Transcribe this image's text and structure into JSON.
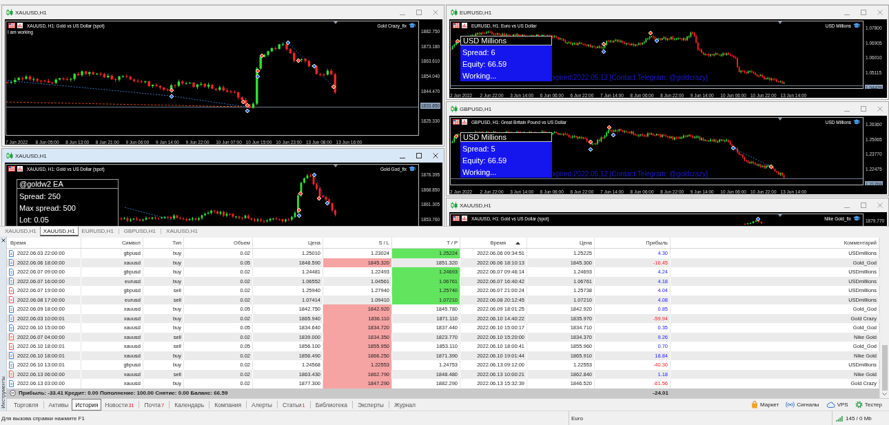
{
  "chart_area": {
    "columns": [
      {
        "windows": [
          {
            "title": "XAUUSD,H1",
            "active": false,
            "chart": {
              "symbol_label": "XAUUSD, H1: Gold vs US Dollar (spot)",
              "expert": "Gold Crazy_fix",
              "comment": "I am working",
              "price_labels": [
                {
                  "text": "1882.750",
                  "current": false
                },
                {
                  "text": "1873.180",
                  "current": false
                },
                {
                  "text": "1863.610",
                  "current": false
                },
                {
                  "text": "1854.040",
                  "current": false
                },
                {
                  "text": "1844.470",
                  "current": false
                },
                {
                  "text": "1833.850",
                  "current": true
                },
                {
                  "text": "1825.330",
                  "current": false
                }
              ],
              "time_labels": [
                "7 Jun 2022",
                "8 Jun 05:00",
                "8 Jun 13:00",
                "8 Jun 21:00",
                "9 Jun 06:00",
                "9 Jun 14:00",
                "9 Jun 22:00",
                "10 Jun 07:00",
                "10 Jun 15:00",
                "10 Jun 23:00",
                "13 Jun 08:00",
                "13 Jun 16:00"
              ]
            }
          },
          {
            "title": "XAUUSD,H1",
            "active": true,
            "chart": {
              "symbol_label": "XAUUSD, H1: Gold vs US Dollar (spot)",
              "expert": "Gold God_fix",
              "panel": {
                "kind": "outline",
                "title": "@goldw2 EA",
                "lines": [
                  "Spread: 250",
                  "Max spread: 500",
                  "Lot: 0.05"
                ]
              },
              "price_labels": [
                {
                  "text": "1876.395",
                  "current": false
                },
                {
                  "text": "1868.850",
                  "current": false
                },
                {
                  "text": "1861.305",
                  "current": false
                },
                {
                  "text": "1853.760",
                  "current": false
                }
              ]
            }
          }
        ]
      },
      {
        "windows": [
          {
            "title": "EURUSD,H1",
            "active": false,
            "chart": {
              "symbol_label": "EURUSD, H1: Euro vs US Dollar",
              "expert": "USD Millions",
              "panel": {
                "kind": "filled",
                "title": "USD Millions",
                "lines": [
                  "Spread: 6",
                  "Equity: 66.59",
                  "Working..."
                ]
              },
              "notice": "xpired:2022.05.12 [Contact Telegram: @goldcrazy]",
              "price_labels": [
                {
                  "text": "1.07800",
                  "current": false
                },
                {
                  "text": "1.06905",
                  "current": false
                },
                {
                  "text": "1.06010",
                  "current": false
                },
                {
                  "text": "1.05115",
                  "current": false
                },
                {
                  "text": "1.04429",
                  "current": true
                }
              ],
              "time_labels": [
                "2 Jun 2022",
                "2 Jun 22:00",
                "3 Jun 14:00",
                "6 Jun 06:00",
                "6 Jun 22:00",
                "7 Jun 14:00",
                "8 Jun 06:00",
                "8 Jun 22:00",
                "9 Jun 14:00",
                "10 Jun 06:00",
                "10 Jun 22:00",
                "13 Jun 14:00"
              ]
            }
          },
          {
            "title": "GBPUSD,H1",
            "active": false,
            "chart": {
              "symbol_label": "GBPUSD, H1: Great Britain Pound vs US Dollar",
              "expert": "USD Millions",
              "panel": {
                "kind": "filled",
                "title": "USD Millions",
                "lines": [
                  "Spread: 5",
                  "Equity: 66.59",
                  "Working..."
                ]
              },
              "notice": "xpired:2022.05.12 [Contact Telegram: @goldcrazy]",
              "price_labels": [
                {
                  "text": "1.26360",
                  "current": false
                },
                {
                  "text": "1.25065",
                  "current": false
                },
                {
                  "text": "1.23770",
                  "current": false
                },
                {
                  "text": "1.22475",
                  "current": false
                },
                {
                  "text": "1.21769",
                  "current": true
                }
              ],
              "time_labels": [
                "2 Jun 2022",
                "2 Jun 22:00",
                "3 Jun 14:00",
                "6 Jun 06:00",
                "6 Jun 22:00",
                "7 Jun 14:00",
                "8 Jun 06:00",
                "8 Jun 22:00",
                "9 Jun 14:00",
                "10 Jun 06:00",
                "10 Jun 22:00",
                "13 Jun 14:00"
              ]
            }
          },
          {
            "title": "XAUUSD,H1",
            "active": false,
            "chart": {
              "symbol_label": "XAUUSD, H1: Gold vs US Dollar (spot)",
              "expert": "Nike Gold_fix",
              "price_labels": [
                {
                  "text": "1879.770",
                  "current": false
                }
              ]
            }
          }
        ]
      }
    ]
  },
  "chart_tabs": [
    {
      "label": "XAUUSD,H1",
      "selected": false
    },
    {
      "label": "XAUUSD,H1",
      "selected": true
    },
    {
      "label": "EURUSD,H1",
      "selected": false
    },
    {
      "label": "GBPUSD,H1",
      "selected": false
    },
    {
      "label": "XAUUSD,H1",
      "selected": false
    }
  ],
  "toolbox": {
    "label": "Инструменты",
    "table": {
      "columns": [
        {
          "label": "Время",
          "sorted": false
        },
        {
          "label": "Символ",
          "sorted": false
        },
        {
          "label": "Тип",
          "sorted": false
        },
        {
          "label": "Объем",
          "sorted": false
        },
        {
          "label": "Цена",
          "sorted": false
        },
        {
          "label": "S / L",
          "sorted": false
        },
        {
          "label": "T / P",
          "sorted": false
        },
        {
          "label": "Время",
          "sorted": true
        },
        {
          "label": "Цена",
          "sorted": false
        },
        {
          "label": "Прибыль",
          "sorted": false
        },
        {
          "label": "Комментарий",
          "sorted": false
        }
      ],
      "rows": [
        {
          "time": "2022.06.03 22:00:00",
          "color": "#3d7fc6",
          "symbol": "gbpusd",
          "type": "buy",
          "volume": "0.02",
          "price": "1.25010",
          "sl": "1.23024",
          "sl_hit": false,
          "tp": "1.25224",
          "tp_hit": true,
          "close_time": "2022.06.06 09:34:51",
          "close_price": "1.25225",
          "profit": "4.30",
          "loss": false,
          "comment": "USDmillions"
        },
        {
          "time": "2022.06.06 18:00:00",
          "color": "#3d7fc6",
          "symbol": "xauusd",
          "type": "buy",
          "volume": "0.05",
          "price": "1848.590",
          "sl": "1845.320",
          "sl_hit": true,
          "tp": "1851.320",
          "tp_hit": false,
          "close_time": "2022.06.06 18:10:13",
          "close_price": "1845.300",
          "profit": "-16.45",
          "loss": true,
          "comment": "Gold_God"
        },
        {
          "time": "2022.06.07 09:00:00",
          "color": "#3d7fc6",
          "symbol": "gbpusd",
          "type": "buy",
          "volume": "0.02",
          "price": "1.24481",
          "sl": "1.22493",
          "sl_hit": false,
          "tp": "1.24693",
          "tp_hit": true,
          "close_time": "2022.06.07 09:46:14",
          "close_price": "1.24693",
          "profit": "4.24",
          "loss": false,
          "comment": "USDmillions"
        },
        {
          "time": "2022.06.07 16:00:00",
          "color": "#3d7fc6",
          "symbol": "eurusd",
          "type": "buy",
          "volume": "0.02",
          "price": "1.06552",
          "sl": "1.04561",
          "sl_hit": false,
          "tp": "1.06761",
          "tp_hit": true,
          "close_time": "2022.06.07 16:40:42",
          "close_price": "1.06761",
          "profit": "4.18",
          "loss": false,
          "comment": "USDmillions"
        },
        {
          "time": "2022.06.07 19:00:00",
          "color": "#e0574a",
          "symbol": "gbpusd",
          "type": "sell",
          "volume": "0.02",
          "price": "1.25940",
          "sl": "1.27940",
          "sl_hit": false,
          "tp": "1.25740",
          "tp_hit": true,
          "close_time": "2022.06.07 21:00:24",
          "close_price": "1.25738",
          "profit": "4.04",
          "loss": false,
          "comment": "USDmillions"
        },
        {
          "time": "2022.06.08 17:00:00",
          "color": "#e0574a",
          "symbol": "eurusd",
          "type": "sell",
          "volume": "0.02",
          "price": "1.07414",
          "sl": "1.09410",
          "sl_hit": false,
          "tp": "1.07210",
          "tp_hit": true,
          "close_time": "2022.06.08 20:12:45",
          "close_price": "1.07210",
          "profit": "4.08",
          "loss": false,
          "comment": "USDmillions"
        },
        {
          "time": "2022.06.09 18:00:00",
          "color": "#3d7fc6",
          "symbol": "xauusd",
          "type": "buy",
          "volume": "0.05",
          "price": "1842.750",
          "sl": "1842.920",
          "sl_hit": true,
          "tp": "1845.780",
          "tp_hit": false,
          "close_time": "2022.06.09 18:01:25",
          "close_price": "1842.920",
          "profit": "0.85",
          "loss": false,
          "comment": "Gold_God"
        },
        {
          "time": "2022.06.03 10:00:01",
          "color": "#3d7fc6",
          "symbol": "xauusd",
          "type": "buy",
          "volume": "0.02",
          "price": "1865.940",
          "sl": "1836.110",
          "sl_hit": true,
          "tp": "1871.110",
          "tp_hit": false,
          "close_time": "2022.06.10 14:40:22",
          "close_price": "1835.970",
          "profit": "-59.94",
          "loss": true,
          "comment": "Gold Crazy"
        },
        {
          "time": "2022.06.10 15:00:00",
          "color": "#3d7fc6",
          "symbol": "xauusd",
          "type": "buy",
          "volume": "0.05",
          "price": "1834.640",
          "sl": "1834.720",
          "sl_hit": true,
          "tp": "1837.440",
          "tp_hit": false,
          "close_time": "2022.06.10 15:00:17",
          "close_price": "1834.710",
          "profit": "0.35",
          "loss": false,
          "comment": "Gold_God"
        },
        {
          "time": "2022.06.07 04:00:00",
          "color": "#e0574a",
          "symbol": "xauusd",
          "type": "sell",
          "volume": "0.02",
          "price": "1839.000",
          "sl": "1834.350",
          "sl_hit": true,
          "tp": "1823.770",
          "tp_hit": false,
          "close_time": "2022.06.10 15:20:00",
          "close_price": "1834.370",
          "profit": "9.26",
          "loss": false,
          "comment": "Nike Gold"
        },
        {
          "time": "2022.06.10 18:00:01",
          "color": "#e0574a",
          "symbol": "xauusd",
          "type": "sell",
          "volume": "0.05",
          "price": "1856.100",
          "sl": "1855.950",
          "sl_hit": true,
          "tp": "1853.110",
          "tp_hit": false,
          "close_time": "2022.06.10 18:00:41",
          "close_price": "1855.960",
          "profit": "0.70",
          "loss": false,
          "comment": "Gold_God"
        },
        {
          "time": "2022.06.10 18:00:01",
          "color": "#3d7fc6",
          "symbol": "xauusd",
          "type": "buy",
          "volume": "0.02",
          "price": "1856.490",
          "sl": "1866.250",
          "sl_hit": true,
          "tp": "1871.390",
          "tp_hit": false,
          "close_time": "2022.06.10 19:01:44",
          "close_price": "1865.910",
          "profit": "18.84",
          "loss": false,
          "comment": "Nike Gold"
        },
        {
          "time": "2022.06.10 13:00:01",
          "color": "#3d7fc6",
          "symbol": "gbpusd",
          "type": "buy",
          "volume": "0.02",
          "price": "1.24568",
          "sl": "1.22553",
          "sl_hit": true,
          "tp": "1.24753",
          "tp_hit": false,
          "close_time": "2022.06.13 09:12:00",
          "close_price": "1.22553",
          "profit": "-40.30",
          "loss": true,
          "comment": "USDmillions"
        },
        {
          "time": "2022.06.13 06:00:00",
          "color": "#e0574a",
          "symbol": "xauusd",
          "type": "sell",
          "volume": "0.02",
          "price": "1863.430",
          "sl": "1862.790",
          "sl_hit": true,
          "tp": "1848.480",
          "tp_hit": false,
          "close_time": "2022.06.13 10:00:21",
          "close_price": "1862.840",
          "profit": "1.18",
          "loss": false,
          "comment": "Nike Gold"
        },
        {
          "time": "2022.06.13 03:00:00",
          "color": "#3d7fc6",
          "symbol": "xauusd",
          "type": "buy",
          "volume": "0.02",
          "price": "1877.300",
          "sl": "1847.290",
          "sl_hit": true,
          "tp": "1882.290",
          "tp_hit": false,
          "close_time": "2022.06.13 15:32:39",
          "close_price": "1846.520",
          "profit": "-61.56",
          "loss": true,
          "comment": "Gold Crazy"
        }
      ],
      "summary": {
        "text": "Прибыль: -33.41 Кредит: 0.00 Пополнение: 100.00 Снятие: 0.00 Баланс: 66.59",
        "total_profit": "-24.01"
      }
    },
    "tabs": [
      {
        "label": "Торговля",
        "selected": false
      },
      {
        "label": "Активы",
        "selected": false
      },
      {
        "label": "История",
        "selected": true
      },
      {
        "label": "Новости",
        "badge": "31",
        "selected": false
      },
      {
        "label": "Почта",
        "badge": "7",
        "selected": false
      },
      {
        "label": "Календарь",
        "selected": false
      },
      {
        "label": "Компания",
        "selected": false
      },
      {
        "label": "Алерты",
        "selected": false
      },
      {
        "label": "Статьи",
        "badge": "1",
        "selected": false
      },
      {
        "label": "Библиотека",
        "selected": false
      },
      {
        "label": "Эксперты",
        "selected": false
      },
      {
        "label": "Журнал",
        "selected": false
      }
    ],
    "tools": [
      {
        "label": "Маркет",
        "kind": "market"
      },
      {
        "label": "Сигналы",
        "kind": "signals"
      },
      {
        "label": "VPS",
        "kind": "vps"
      },
      {
        "label": "Тестер",
        "kind": "tester"
      }
    ]
  },
  "status_bar": {
    "help": "Для вызова справки нажмите F1",
    "profile": "Euro",
    "traffic": "145 / 0 Mb"
  }
}
